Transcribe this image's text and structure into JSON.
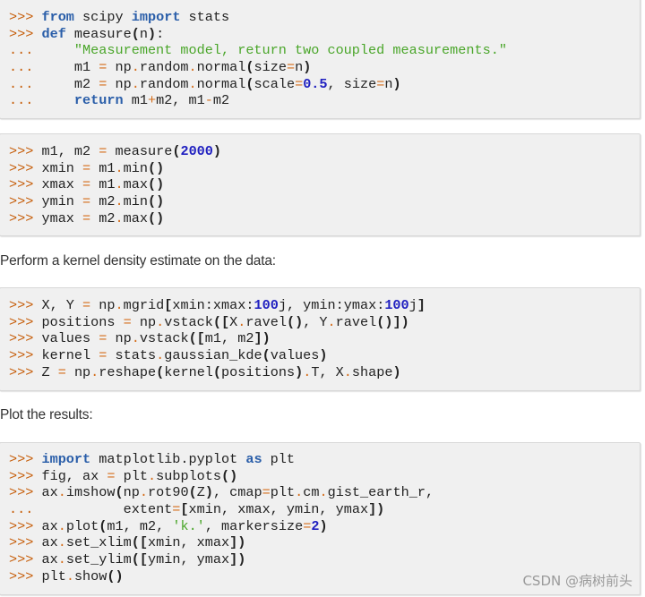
{
  "code_blocks": [
    {
      "lines": [
        [
          [
            "pr",
            ">>> "
          ],
          [
            "kw",
            "from"
          ],
          [
            "",
            " scipy "
          ],
          [
            "kw",
            "import"
          ],
          [
            "",
            " stats"
          ]
        ],
        [
          [
            "pr",
            ">>> "
          ],
          [
            "kw",
            "def"
          ],
          [
            "",
            " measure"
          ],
          [
            "par",
            "("
          ],
          [
            "",
            "n"
          ],
          [
            "par",
            ")"
          ],
          [
            "",
            ":"
          ]
        ],
        [
          [
            "pr",
            "...     "
          ],
          [
            "str",
            "\"Measurement model, return two coupled measurements.\""
          ]
        ],
        [
          [
            "pr",
            "...     "
          ],
          [
            "",
            "m1 "
          ],
          [
            "op",
            "="
          ],
          [
            "",
            " np"
          ],
          [
            "op",
            "."
          ],
          [
            "",
            "random"
          ],
          [
            "op",
            "."
          ],
          [
            "",
            "normal"
          ],
          [
            "par",
            "("
          ],
          [
            "",
            "size"
          ],
          [
            "op",
            "="
          ],
          [
            "",
            "n"
          ],
          [
            "par",
            ")"
          ]
        ],
        [
          [
            "pr",
            "...     "
          ],
          [
            "",
            "m2 "
          ],
          [
            "op",
            "="
          ],
          [
            "",
            " np"
          ],
          [
            "op",
            "."
          ],
          [
            "",
            "random"
          ],
          [
            "op",
            "."
          ],
          [
            "",
            "normal"
          ],
          [
            "par",
            "("
          ],
          [
            "",
            "scale"
          ],
          [
            "op",
            "="
          ],
          [
            "num",
            "0.5"
          ],
          [
            "",
            ", size"
          ],
          [
            "op",
            "="
          ],
          [
            "",
            "n"
          ],
          [
            "par",
            ")"
          ]
        ],
        [
          [
            "pr",
            "...     "
          ],
          [
            "kw",
            "return"
          ],
          [
            "",
            " m1"
          ],
          [
            "op",
            "+"
          ],
          [
            "",
            "m2, m1"
          ],
          [
            "op",
            "-"
          ],
          [
            "",
            "m2"
          ]
        ]
      ]
    },
    {
      "lines": [
        [
          [
            "pr",
            ">>> "
          ],
          [
            "",
            "m1, m2 "
          ],
          [
            "op",
            "="
          ],
          [
            "",
            " measure"
          ],
          [
            "par",
            "("
          ],
          [
            "num",
            "2000"
          ],
          [
            "par",
            ")"
          ]
        ],
        [
          [
            "pr",
            ">>> "
          ],
          [
            "",
            "xmin "
          ],
          [
            "op",
            "="
          ],
          [
            "",
            " m1"
          ],
          [
            "op",
            "."
          ],
          [
            "",
            "min"
          ],
          [
            "par",
            "()"
          ]
        ],
        [
          [
            "pr",
            ">>> "
          ],
          [
            "",
            "xmax "
          ],
          [
            "op",
            "="
          ],
          [
            "",
            " m1"
          ],
          [
            "op",
            "."
          ],
          [
            "",
            "max"
          ],
          [
            "par",
            "()"
          ]
        ],
        [
          [
            "pr",
            ">>> "
          ],
          [
            "",
            "ymin "
          ],
          [
            "op",
            "="
          ],
          [
            "",
            " m2"
          ],
          [
            "op",
            "."
          ],
          [
            "",
            "min"
          ],
          [
            "par",
            "()"
          ]
        ],
        [
          [
            "pr",
            ">>> "
          ],
          [
            "",
            "ymax "
          ],
          [
            "op",
            "="
          ],
          [
            "",
            " m2"
          ],
          [
            "op",
            "."
          ],
          [
            "",
            "max"
          ],
          [
            "par",
            "()"
          ]
        ]
      ]
    },
    {
      "lines": [
        [
          [
            "pr",
            ">>> "
          ],
          [
            "",
            "X, Y "
          ],
          [
            "op",
            "="
          ],
          [
            "",
            " np"
          ],
          [
            "op",
            "."
          ],
          [
            "",
            "mgrid"
          ],
          [
            "par",
            "["
          ],
          [
            "",
            "xmin:xmax:"
          ],
          [
            "num",
            "100"
          ],
          [
            "",
            "j, ymin:ymax:"
          ],
          [
            "num",
            "100"
          ],
          [
            "",
            "j"
          ],
          [
            "par",
            "]"
          ]
        ],
        [
          [
            "pr",
            ">>> "
          ],
          [
            "",
            "positions "
          ],
          [
            "op",
            "="
          ],
          [
            "",
            " np"
          ],
          [
            "op",
            "."
          ],
          [
            "",
            "vstack"
          ],
          [
            "par",
            "(["
          ],
          [
            "",
            "X"
          ],
          [
            "op",
            "."
          ],
          [
            "",
            "ravel"
          ],
          [
            "par",
            "()"
          ],
          [
            "",
            ", Y"
          ],
          [
            "op",
            "."
          ],
          [
            "",
            "ravel"
          ],
          [
            "par",
            "()])"
          ]
        ],
        [
          [
            "pr",
            ">>> "
          ],
          [
            "",
            "values "
          ],
          [
            "op",
            "="
          ],
          [
            "",
            " np"
          ],
          [
            "op",
            "."
          ],
          [
            "",
            "vstack"
          ],
          [
            "par",
            "(["
          ],
          [
            "",
            "m1, m2"
          ],
          [
            "par",
            "])"
          ]
        ],
        [
          [
            "pr",
            ">>> "
          ],
          [
            "",
            "kernel "
          ],
          [
            "op",
            "="
          ],
          [
            "",
            " stats"
          ],
          [
            "op",
            "."
          ],
          [
            "",
            "gaussian_kde"
          ],
          [
            "par",
            "("
          ],
          [
            "",
            "values"
          ],
          [
            "par",
            ")"
          ]
        ],
        [
          [
            "pr",
            ">>> "
          ],
          [
            "",
            "Z "
          ],
          [
            "op",
            "="
          ],
          [
            "",
            " np"
          ],
          [
            "op",
            "."
          ],
          [
            "",
            "reshape"
          ],
          [
            "par",
            "("
          ],
          [
            "",
            "kernel"
          ],
          [
            "par",
            "("
          ],
          [
            "",
            "positions"
          ],
          [
            "par",
            ")"
          ],
          [
            "op",
            "."
          ],
          [
            "",
            "T, X"
          ],
          [
            "op",
            "."
          ],
          [
            "",
            "shape"
          ],
          [
            "par",
            ")"
          ]
        ]
      ]
    },
    {
      "lines": [
        [
          [
            "pr",
            ">>> "
          ],
          [
            "kw",
            "import"
          ],
          [
            "",
            " matplotlib.pyplot "
          ],
          [
            "kw",
            "as"
          ],
          [
            "",
            " plt"
          ]
        ],
        [
          [
            "pr",
            ">>> "
          ],
          [
            "",
            "fig, ax "
          ],
          [
            "op",
            "="
          ],
          [
            "",
            " plt"
          ],
          [
            "op",
            "."
          ],
          [
            "",
            "subplots"
          ],
          [
            "par",
            "()"
          ]
        ],
        [
          [
            "pr",
            ">>> "
          ],
          [
            "",
            "ax"
          ],
          [
            "op",
            "."
          ],
          [
            "",
            "imshow"
          ],
          [
            "par",
            "("
          ],
          [
            "",
            "np"
          ],
          [
            "op",
            "."
          ],
          [
            "",
            "rot90"
          ],
          [
            "par",
            "("
          ],
          [
            "",
            "Z"
          ],
          [
            "par",
            ")"
          ],
          [
            "",
            ", cmap"
          ],
          [
            "op",
            "="
          ],
          [
            "",
            "plt"
          ],
          [
            "op",
            "."
          ],
          [
            "",
            "cm"
          ],
          [
            "op",
            "."
          ],
          [
            "",
            "gist_earth_r,"
          ]
        ],
        [
          [
            "pr",
            "...           "
          ],
          [
            "",
            "extent"
          ],
          [
            "op",
            "="
          ],
          [
            "par",
            "["
          ],
          [
            "",
            "xmin, xmax, ymin, ymax"
          ],
          [
            "par",
            "])"
          ]
        ],
        [
          [
            "pr",
            ">>> "
          ],
          [
            "",
            "ax"
          ],
          [
            "op",
            "."
          ],
          [
            "",
            "plot"
          ],
          [
            "par",
            "("
          ],
          [
            "",
            "m1, m2, "
          ],
          [
            "str",
            "'k.'"
          ],
          [
            "",
            ", markersize"
          ],
          [
            "op",
            "="
          ],
          [
            "num",
            "2"
          ],
          [
            "par",
            ")"
          ]
        ],
        [
          [
            "pr",
            ">>> "
          ],
          [
            "",
            "ax"
          ],
          [
            "op",
            "."
          ],
          [
            "",
            "set_xlim"
          ],
          [
            "par",
            "(["
          ],
          [
            "",
            "xmin, xmax"
          ],
          [
            "par",
            "])"
          ]
        ],
        [
          [
            "pr",
            ">>> "
          ],
          [
            "",
            "ax"
          ],
          [
            "op",
            "."
          ],
          [
            "",
            "set_ylim"
          ],
          [
            "par",
            "(["
          ],
          [
            "",
            "ymin, ymax"
          ],
          [
            "par",
            "])"
          ]
        ],
        [
          [
            "pr",
            ">>> "
          ],
          [
            "",
            "plt"
          ],
          [
            "op",
            "."
          ],
          [
            "",
            "show"
          ],
          [
            "par",
            "()"
          ]
        ]
      ]
    }
  ],
  "prose": {
    "kde_intro": "Perform a kernel density estimate on the data:",
    "plot_intro": "Plot the results:"
  },
  "watermark": "CSDN @病树前头"
}
